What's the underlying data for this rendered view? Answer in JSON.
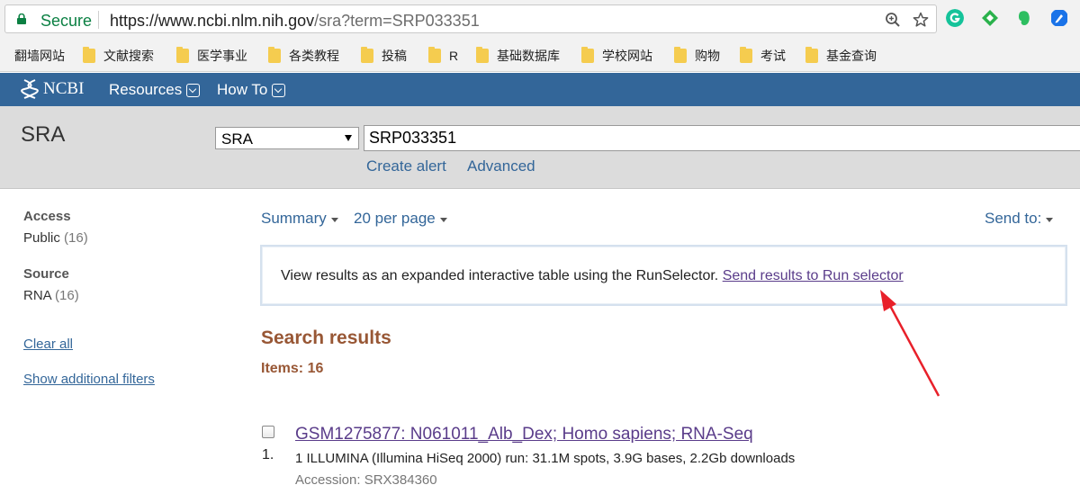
{
  "browser": {
    "secure_label": "Secure",
    "url_host": "https://www.ncbi.nlm.nih.gov",
    "url_rest": "/sra?term=SRP033351",
    "icons": [
      "lock-icon",
      "zoom-icon",
      "star-icon",
      "grammarly-icon",
      "feedly-icon",
      "evernote-icon",
      "extension-icon"
    ]
  },
  "bookmarks": [
    "翻墙网站",
    "文献搜索",
    "医学事业",
    "各类教程",
    "投稿",
    "R",
    "基础数据库",
    "学校网站",
    "购物",
    "考试",
    "基金查询"
  ],
  "header": {
    "logo": "NCBI",
    "nav": [
      "Resources",
      "How To"
    ],
    "color": "#336699"
  },
  "search": {
    "db_title": "SRA",
    "db_selected": "SRA",
    "term": "SRP033351",
    "links": [
      "Create alert",
      "Advanced"
    ]
  },
  "sidebar": {
    "facets": [
      {
        "title": "Access",
        "items": [
          {
            "label": "Public",
            "count": "(16)"
          }
        ]
      },
      {
        "title": "Source",
        "items": [
          {
            "label": "RNA",
            "count": "(16)"
          }
        ]
      }
    ],
    "clear_all": "Clear all",
    "show_filters": "Show additional filters"
  },
  "display": {
    "format": "Summary",
    "per_page": "20 per page",
    "send_to": "Send to:"
  },
  "run_selector": {
    "text": "View results as an expanded interactive table using the RunSelector.",
    "link": "Send results to Run selector"
  },
  "results": {
    "title": "Search results",
    "items_label": "Items: 16",
    "list": [
      {
        "index": "1.",
        "title": "GSM1275877: N061011_Alb_Dex; Homo sapiens; RNA-Seq",
        "description": "1 ILLUMINA (Illumina HiSeq 2000) run: 31.1M spots, 3.9G bases, 2.2Gb downloads",
        "accession": "Accession: SRX384360"
      }
    ]
  },
  "annotation": {
    "arrow_color": "#e8202a"
  }
}
